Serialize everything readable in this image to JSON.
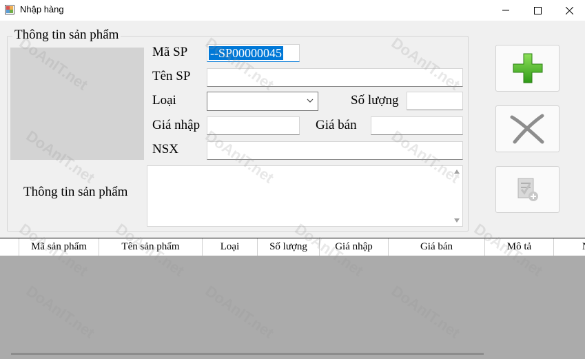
{
  "window": {
    "title": "Nhập hàng",
    "minimize_glyph": "—",
    "maximize_glyph": "☐",
    "close_glyph": "✕"
  },
  "product_group": {
    "legend": "Thông tin sản phẩm",
    "labels": {
      "code": "Mã SP",
      "name": "Tên SP",
      "type": "Loại",
      "quantity": "Số lượng",
      "import_price": "Giá nhập",
      "sell_price": "Giá bán",
      "manufacturer": "NSX",
      "description": "Thông tin sản phẩm"
    },
    "fields": {
      "code": "--SP00000045",
      "name": "",
      "type": "",
      "quantity": "",
      "import_price": "",
      "sell_price": "",
      "manufacturer": "",
      "description": ""
    }
  },
  "actions": {
    "add": "add-icon",
    "cancel": "cancel-icon",
    "save": "save-icon"
  },
  "grid": {
    "columns": [
      "Mã sản phẩm",
      "Tên sản phẩm",
      "Loại",
      "Số lượng",
      "Giá nhập",
      "Giá bán",
      "Mô tả",
      "NS"
    ]
  },
  "watermark": {
    "text": "DoAnIT.net"
  }
}
